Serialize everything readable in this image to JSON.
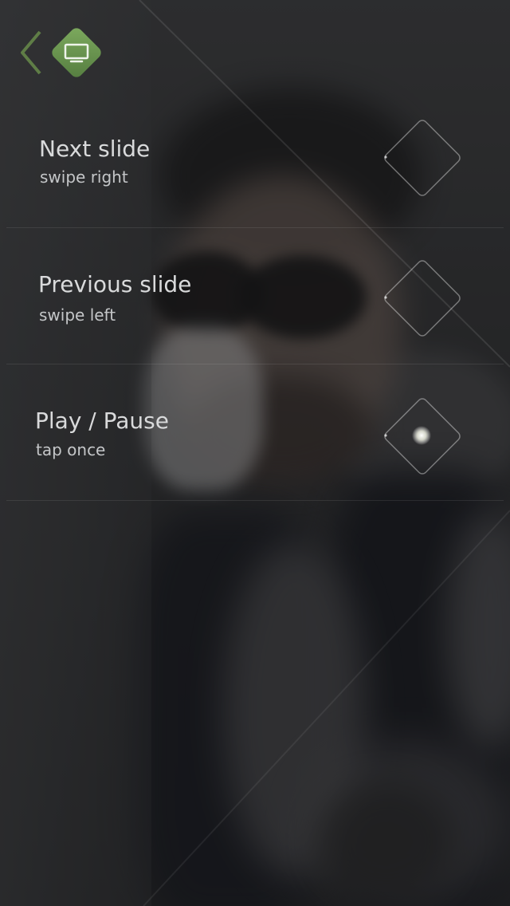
{
  "header": {
    "back_icon": "chevron-left-icon",
    "app_icon": "monitor-icon",
    "accent_color": "#6f9a55"
  },
  "gestures": [
    {
      "title": "Next slide",
      "hint": "swipe right",
      "icon": "swipe-right-icon"
    },
    {
      "title": "Previous slide",
      "hint": "swipe left",
      "icon": "swipe-left-icon"
    },
    {
      "title": "Play / Pause",
      "hint": "tap once",
      "icon": "tap-icon"
    }
  ]
}
